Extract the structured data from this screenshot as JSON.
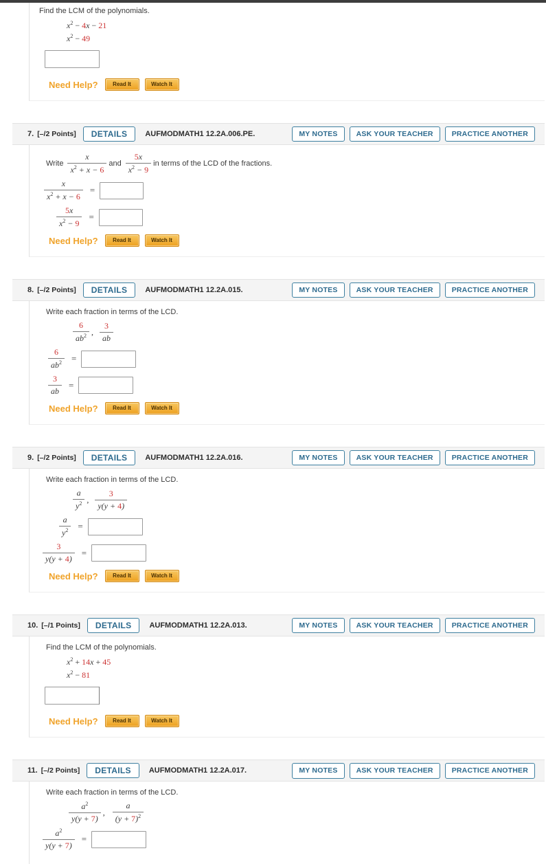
{
  "page": {
    "top_bar_color": "#3d3d3d",
    "accent_blue": "#2d6a8e",
    "accent_orange": "#f0a32a",
    "math_red": "#cc3333"
  },
  "labels": {
    "details": "DETAILS",
    "my_notes": "MY NOTES",
    "ask_your_teacher": "ASK YOUR TEACHER",
    "practice_another": "PRACTICE ANOTHER",
    "need_help": "Need Help?",
    "read_it": "Read It",
    "watch_it": "Watch It",
    "equals": "="
  },
  "questions": [
    {
      "id": "q6-partial",
      "number": "",
      "points": "",
      "code": "",
      "prompt": "Find the LCM of the polynomials.",
      "type": "lcm",
      "polynomials": [
        {
          "base": "x",
          "exp": "2",
          "terms": " − 4x − 21",
          "red": [
            "4",
            "21"
          ]
        },
        {
          "base": "x",
          "exp": "2",
          "terms": " − 49",
          "red": [
            "49"
          ]
        }
      ],
      "poly_text": [
        "x2 − 4x − 21",
        "x2 − 49"
      ],
      "answer_value": ""
    },
    {
      "id": "q7",
      "number": "7.",
      "points": "[–/2 Points]",
      "code": "AUFMODMATH1 12.2A.006.PE.",
      "prompt_pre": "Write",
      "prompt_mid": "and",
      "prompt_post": "in terms of the LCD of the fractions.",
      "type": "lcd-two",
      "fractions": [
        {
          "num": "x",
          "num_red": false,
          "den": "x2 + x − 6"
        },
        {
          "num": "5x",
          "num_red": true,
          "den": "x2 − 9"
        }
      ],
      "answer_values": [
        "",
        ""
      ]
    },
    {
      "id": "q8",
      "number": "8.",
      "points": "[–/2 Points]",
      "code": "AUFMODMATH1 12.2A.015.",
      "prompt": "Write each fraction in terms of the LCD.",
      "type": "lcd-two",
      "fractions": [
        {
          "num": "6",
          "num_red": true,
          "den": "ab2"
        },
        {
          "num": "3",
          "num_red": true,
          "den": "ab"
        }
      ],
      "answer_values": [
        "",
        ""
      ]
    },
    {
      "id": "q9",
      "number": "9.",
      "points": "[–/2 Points]",
      "code": "AUFMODMATH1 12.2A.016.",
      "prompt": "Write each fraction in terms of the LCD.",
      "type": "lcd-two",
      "fractions": [
        {
          "num": "a",
          "num_red": false,
          "den": "y2"
        },
        {
          "num": "3",
          "num_red": true,
          "den": "y(y + 4)"
        }
      ],
      "answer_values": [
        "",
        ""
      ]
    },
    {
      "id": "q10",
      "number": "10.",
      "points": "[–/1 Points]",
      "code": "AUFMODMATH1 12.2A.013.",
      "prompt": "Find the LCM of the polynomials.",
      "type": "lcm",
      "poly_text": [
        "x2 + 14x + 45",
        "x2 − 81"
      ],
      "answer_value": ""
    },
    {
      "id": "q11",
      "number": "11.",
      "points": "[–/2 Points]",
      "code": "AUFMODMATH1 12.2A.017.",
      "prompt": "Write each fraction in terms of the LCD.",
      "type": "lcd-two",
      "fractions": [
        {
          "num": "a2",
          "num_red": false,
          "den": "y(y + 7)"
        },
        {
          "num": "a",
          "num_red": false,
          "den": "(y + 7)2"
        }
      ],
      "answer_values": [
        ""
      ]
    }
  ]
}
